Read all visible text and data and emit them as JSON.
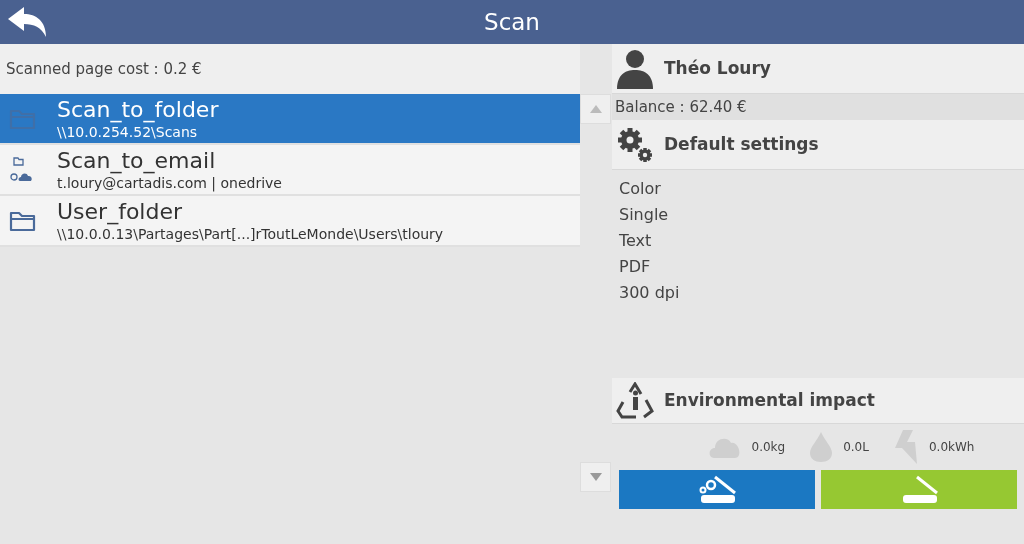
{
  "header": {
    "title": "Scan"
  },
  "cost": "Scanned page cost : 0.2 €",
  "destinations": [
    {
      "kind": "folder",
      "name": "Scan_to_folder",
      "detail": "\\\\10.0.254.52\\Scans",
      "selected": true
    },
    {
      "kind": "email",
      "name": "Scan_to_email",
      "detail": "t.loury@cartadis.com | onedrive",
      "selected": false
    },
    {
      "kind": "folder",
      "name": "User_folder",
      "detail": "\\\\10.0.0.13\\Partages\\Part[...]rToutLeMonde\\Users\\tloury",
      "selected": false
    }
  ],
  "user": {
    "name": "Théo Loury",
    "balance": "Balance : 62.40 €"
  },
  "settings": {
    "title": "Default settings",
    "items": [
      "Color",
      "Single",
      "Text",
      "PDF",
      "300 dpi"
    ]
  },
  "environment": {
    "title": "Environmental impact",
    "stats": [
      {
        "kind": "co2",
        "value": "0.0kg"
      },
      {
        "kind": "water",
        "value": "0.0L"
      },
      {
        "kind": "energy",
        "value": "0.0kWh"
      }
    ]
  }
}
